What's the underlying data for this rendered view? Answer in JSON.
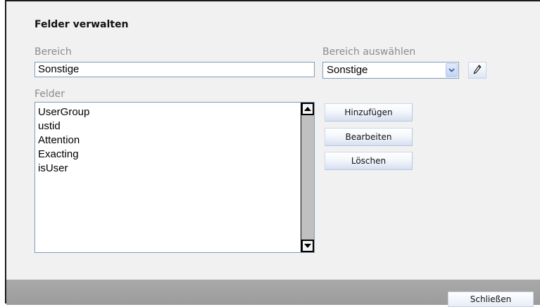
{
  "dialog": {
    "title": "Felder verwalten",
    "bereich_label": "Bereich",
    "bereich_value": "Sonstige",
    "bereich_auswaehlen_label": "Bereich auswählen",
    "bereich_select_value": "Sonstige",
    "felder_label": "Felder",
    "felder_items": [
      "UserGroup",
      "ustid",
      "Attention",
      "Exacting",
      "isUser"
    ],
    "buttons": {
      "add": "Hinzufügen",
      "edit": "Bearbeiten",
      "delete": "Löschen",
      "close": "Schließen"
    }
  },
  "icons": {
    "select_arrow": "chevron-down-icon",
    "edit": "pencil-icon",
    "scroll_up": "arrow-up-icon",
    "scroll_down": "arrow-down-icon"
  },
  "colors": {
    "background": "#f1f1f1",
    "label": "#8c8c8c",
    "input_border": "#7f9db9",
    "footer": "#a3a3a3",
    "scrollbar": "#c0c0c0"
  }
}
